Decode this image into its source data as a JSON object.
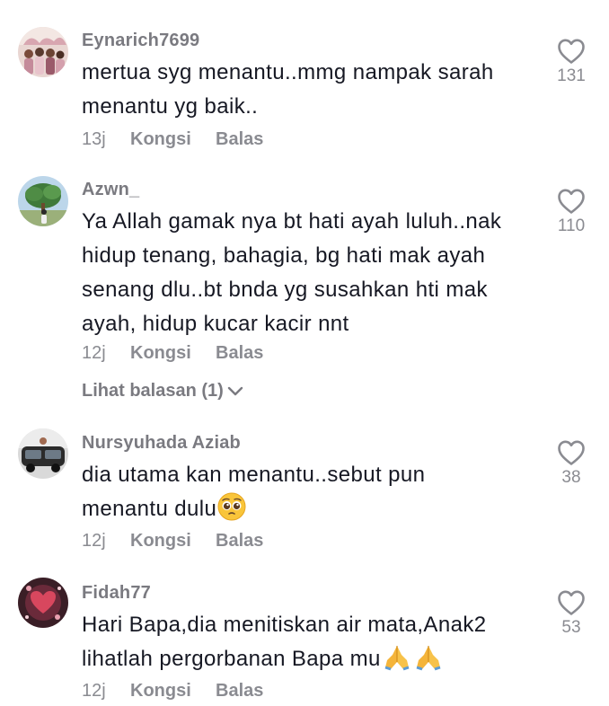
{
  "comments": [
    {
      "username": "Eynarich7699",
      "lines": [
        "mertua syg menantu..mmg nampak sarah",
        "menantu yg baik.."
      ],
      "time": "13j",
      "share": "Kongsi",
      "reply": "Balas",
      "likes": "131"
    },
    {
      "username": "Azwn_",
      "lines": [
        "Ya Allah gamak nya bt hati ayah luluh..nak",
        "hidup tenang, bahagia, bg hati mak ayah",
        "senang dlu..bt bnda yg susahkan hti mak",
        "ayah, hidup kucar kacir nnt"
      ],
      "time": "12j",
      "share": "Kongsi",
      "reply": "Balas",
      "likes": "110",
      "view_replies": "Lihat balasan (1)"
    },
    {
      "username": "Nursyuhada Aziab",
      "lines": [
        "dia utama kan menantu..sebut pun",
        "menantu dulu"
      ],
      "time": "12j",
      "share": "Kongsi",
      "reply": "Balas",
      "likes": "38"
    },
    {
      "username": "Fidah77",
      "lines": [
        "Hari Bapa,dia menitiskan air mata,Anak2",
        "lihatlah pergorbanan Bapa mu"
      ],
      "time": "12j",
      "share": "Kongsi",
      "reply": "Balas",
      "likes": "53"
    }
  ],
  "icons": {
    "like": "heart-outline-icon",
    "expand": "chevron-down-icon",
    "emoji_pleading": "pleading-face-emoji",
    "emoji_pray": "folded-hands-emoji"
  },
  "colors": {
    "text": "#161823",
    "muted": "#8a8b91",
    "username": "#7a7a80",
    "background": "#ffffff"
  }
}
